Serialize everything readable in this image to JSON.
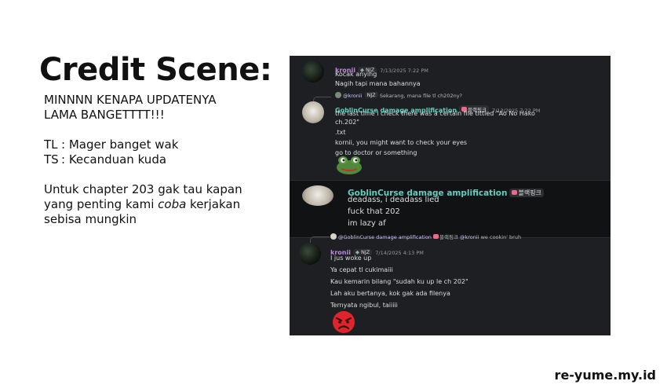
{
  "left": {
    "title": "Credit Scene:",
    "headline": [
      "MINNNN KENAPA UPDATENYA",
      "LAMA BANGETTTT!!!"
    ],
    "tl_key": "TL",
    "tl_value": ": Mager banget wak",
    "ts_key": "TS",
    "ts_value": ": Kecanduan kuda",
    "footer_1": "Untuk chapter 203 gak tau kapan",
    "footer_2_pre": "yang penting kami ",
    "footer_2_em": "coba",
    "footer_2_post": " kerjakan",
    "footer_3": "sebisa mungkin"
  },
  "watermark": "re-yume.my.id",
  "chat": {
    "msg1": {
      "user": "kronii",
      "tag": "NJZ",
      "time": "7/13/2025 7:22 PM",
      "lines": [
        "Kocak anying",
        "Nagih tapi mana bahannya"
      ]
    },
    "msg2": {
      "reply_user": "@kronii",
      "reply_tag": "NJZ",
      "reply_text": "Sekarang, mana file tl ch202ny?",
      "user": "GoblinCurse damage amplification",
      "tag": "블랙핑크",
      "time": "7/13/2025 7:22 PM",
      "lines": [
        "the last time i check there was a certain file tittled \"Ao No Hako",
        "ch.202\"",
        ".txt",
        "kornii, you might want to check your eyes",
        "go to doctor or something"
      ]
    },
    "msg3": {
      "user": "GoblinCurse damage amplification",
      "tag": "블랙핑크",
      "lines": [
        "deadass, i deadass lied",
        "fuck that 202",
        "im lazy af"
      ]
    },
    "msg4": {
      "reply_user": "@GoblinCurse damage amplification",
      "reply_tag": "블랙핑크",
      "reply_mention": "@kronii",
      "reply_text": "we cookin' bruh",
      "user": "kronii",
      "tag": "NJZ",
      "time": "7/14/2025 4:13 PM",
      "lines": [
        "I jus woke up",
        "Ya cepat tl cukimaiii",
        "Kau kemarin bilang \"sudah ku up le ch 202\"",
        "Lah aku bertanya, kok gak ada filenya",
        "Ternyata ngibul, taiiiii"
      ]
    }
  }
}
